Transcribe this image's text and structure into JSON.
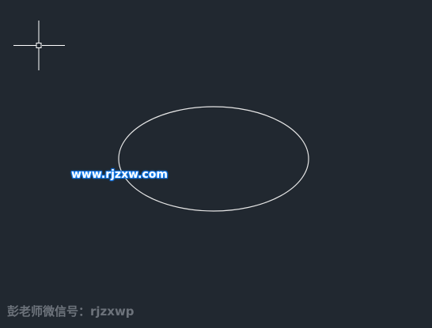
{
  "canvas": {
    "background_color": "#212830",
    "stroke_color": "#e6e6e6"
  },
  "cursor": {
    "icon": "crosshair-pickbox-icon"
  },
  "shapes": [
    {
      "type": "ellipse",
      "name": "ellipse-shape"
    }
  ],
  "watermarks": {
    "url": "www.rjzxw.com",
    "wechat": "彭老师微信号：rjzxwp"
  }
}
